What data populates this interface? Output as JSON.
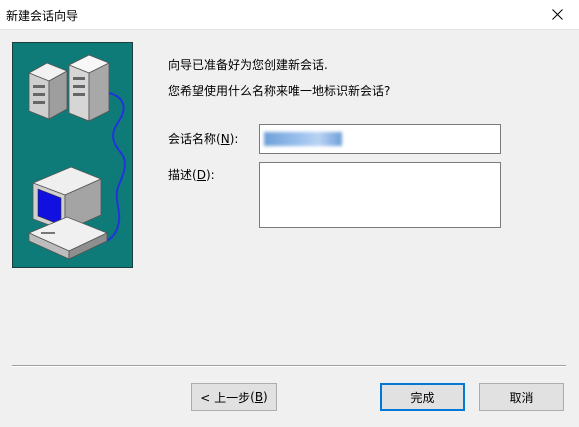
{
  "window": {
    "title": "新建会话向导",
    "close_icon": "close-icon"
  },
  "intro": {
    "line1": "向导已准备好为您创建新会话.",
    "line2": "您希望使用什么名称来唯一地标识新会话?"
  },
  "form": {
    "name_label": "会话名称",
    "name_mnemonic": "N",
    "name_value": "████████",
    "desc_label": "描述",
    "desc_mnemonic": "D",
    "desc_value": ""
  },
  "buttons": {
    "back_prefix": "< 上一步",
    "back_mnemonic": "B",
    "finish": "完成",
    "cancel": "取消"
  },
  "colors": {
    "panel_bg": "#0f7b78",
    "accent_border": "#0078d7",
    "screen_blue": "#1010e0",
    "cable_blue": "#2233dd"
  },
  "illustration": {
    "icon": "network-computers-icon"
  }
}
